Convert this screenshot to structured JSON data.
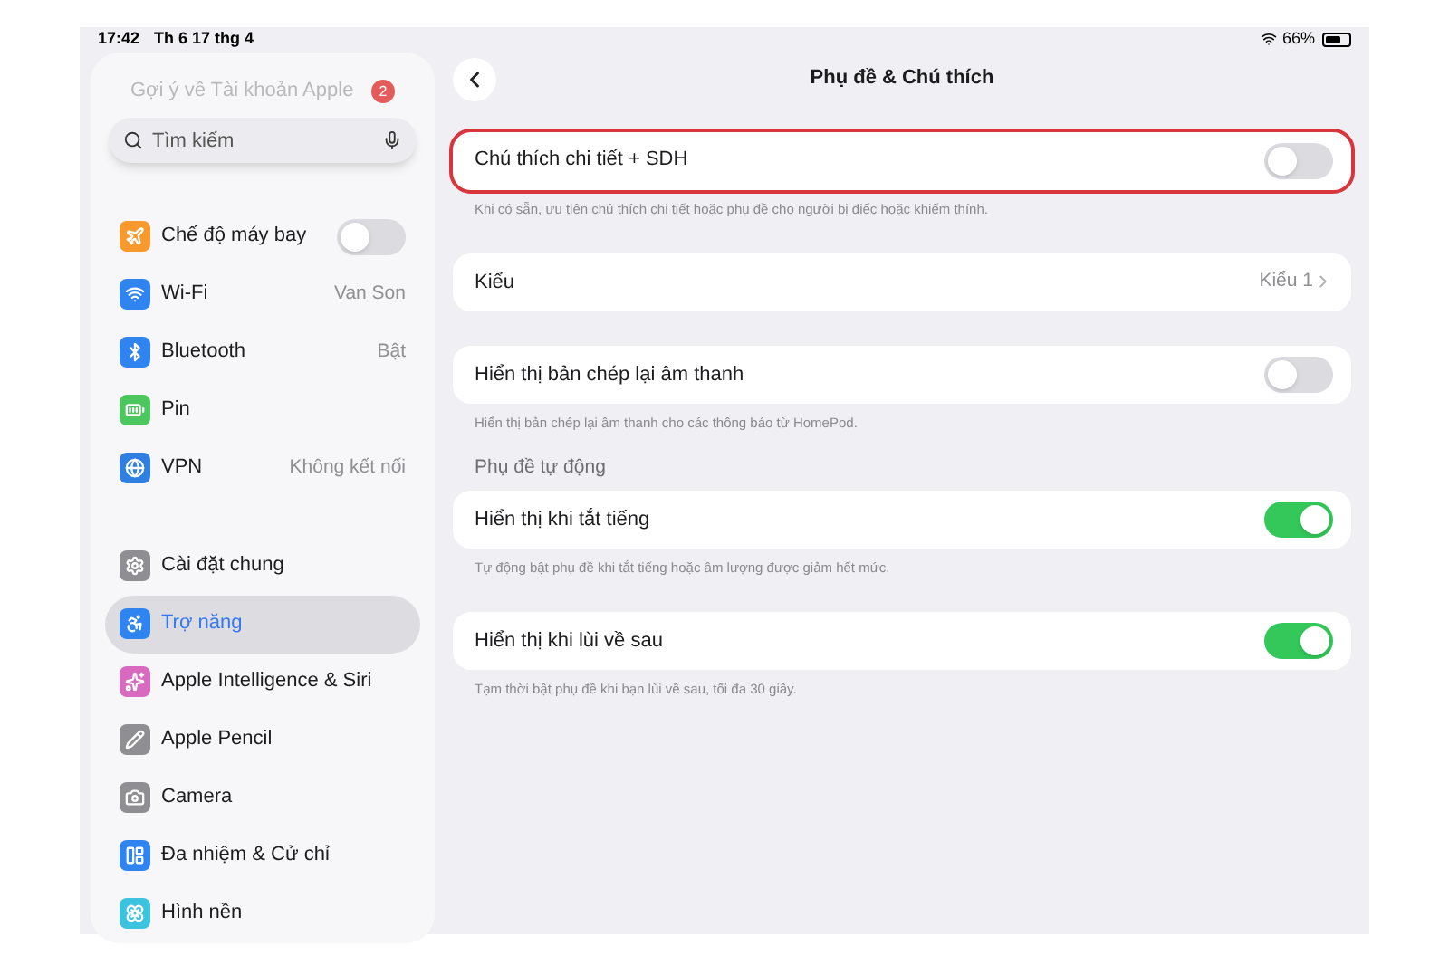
{
  "status_bar": {
    "time": "17:42",
    "date": "Th 6 17 thg 4",
    "battery": "66%"
  },
  "sidebar": {
    "suggestion": {
      "label": "Gợi ý về Tài khoản Apple",
      "badge": "2"
    },
    "search": {
      "placeholder": "Tìm kiếm"
    },
    "groups": [
      [
        {
          "label": "Chế độ máy bay",
          "kind": "toggle",
          "on": false,
          "selected": false,
          "color": "#f7992d"
        },
        {
          "label": "Wi-Fi",
          "kind": "value",
          "value": "Van Son",
          "selected": false,
          "color": "#2f84f0"
        },
        {
          "label": "Bluetooth",
          "kind": "value",
          "value": "Bật",
          "selected": false,
          "color": "#2f84f0"
        },
        {
          "label": "Pin",
          "kind": "plain",
          "selected": false,
          "color": "#4cc75e"
        },
        {
          "label": "VPN",
          "kind": "value",
          "value": "Không kết nối",
          "selected": false,
          "color": "#2f7fe0"
        }
      ],
      [
        {
          "label": "Cài đặt chung",
          "kind": "plain",
          "selected": false,
          "color": "#8e8e93"
        },
        {
          "label": "Trợ năng",
          "kind": "plain",
          "selected": true,
          "color": "#2f84f0"
        },
        {
          "label": "Apple Intelligence & Siri",
          "kind": "plain",
          "selected": false,
          "color": "#d86ac0"
        },
        {
          "label": "Apple Pencil",
          "kind": "plain",
          "selected": false,
          "color": "#8e8e93"
        },
        {
          "label": "Camera",
          "kind": "plain",
          "selected": false,
          "color": "#8e8e93"
        },
        {
          "label": "Đa nhiệm & Cử chỉ",
          "kind": "plain",
          "selected": false,
          "color": "#2f84f0"
        },
        {
          "label": "Hình nền",
          "kind": "plain",
          "selected": false,
          "color": "#3cc3e0"
        }
      ]
    ]
  },
  "main": {
    "title": "Phụ đề & Chú thích",
    "sections": [
      {
        "rows": [
          {
            "kind": "toggle",
            "label": "Chú thích chi tiết + SDH",
            "on": false,
            "highlighted": true
          }
        ],
        "footer": "Khi có sẵn, ưu tiên chú thích chi tiết hoặc phụ đề cho người bị điếc hoặc khiếm thính."
      },
      {
        "rows": [
          {
            "kind": "link",
            "label": "Kiểu",
            "value": "Kiểu 1",
            "highlighted": false
          }
        ]
      },
      {
        "rows": [
          {
            "kind": "toggle",
            "label": "Hiển thị bản chép lại âm thanh",
            "on": false,
            "highlighted": false
          }
        ],
        "footer": "Hiển thị bản chép lại âm thanh cho các thông báo từ HomePod."
      },
      {
        "header": "Phụ đề tự động",
        "rows": [
          {
            "kind": "toggle",
            "label": "Hiển thị khi tắt tiếng",
            "on": true,
            "highlighted": false
          }
        ],
        "footer": "Tự động bật phụ đề khi tắt tiếng hoặc âm lượng được giảm hết mức."
      },
      {
        "rows": [
          {
            "kind": "toggle",
            "label": "Hiển thị khi lùi về sau",
            "on": true,
            "highlighted": false
          }
        ],
        "footer": "Tạm thời bật phụ đề khi bạn lùi về sau, tối đa 30 giây."
      }
    ]
  }
}
